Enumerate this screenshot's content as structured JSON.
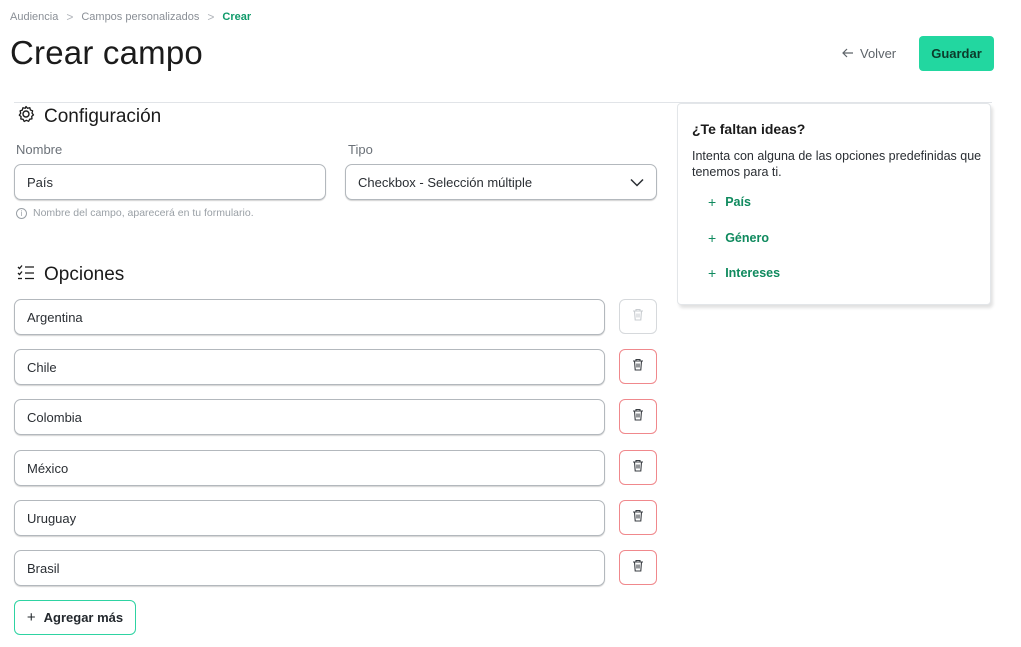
{
  "breadcrumb": {
    "items": [
      "Audiencia",
      "Campos personalizados"
    ],
    "current": "Crear",
    "separator": ">"
  },
  "header": {
    "title": "Crear campo",
    "back_label": "Volver",
    "save_label": "Guardar"
  },
  "config": {
    "title": "Configuración",
    "icon": "gear-icon",
    "name_label": "Nombre",
    "name_value": "País",
    "type_label": "Tipo",
    "type_value": "Checkbox - Selección múltiple",
    "helper": "Nombre del campo, aparecerá en tu formulario."
  },
  "options": {
    "title": "Opciones",
    "icon": "checklist-icon",
    "items": [
      "Argentina",
      "Chile",
      "Colombia",
      "México",
      "Uruguay",
      "Brasil"
    ],
    "add_label": "Agregar más"
  },
  "ideas": {
    "title": "¿Te faltan ideas?",
    "description": "Intenta con alguna de las opciones predefinidas que tenemos para ti.",
    "items": [
      "País",
      "Género",
      "Intereses"
    ]
  },
  "colors": {
    "accent": "#22d7a0",
    "link": "#0f8a5e",
    "danger_border": "#f0888c"
  }
}
